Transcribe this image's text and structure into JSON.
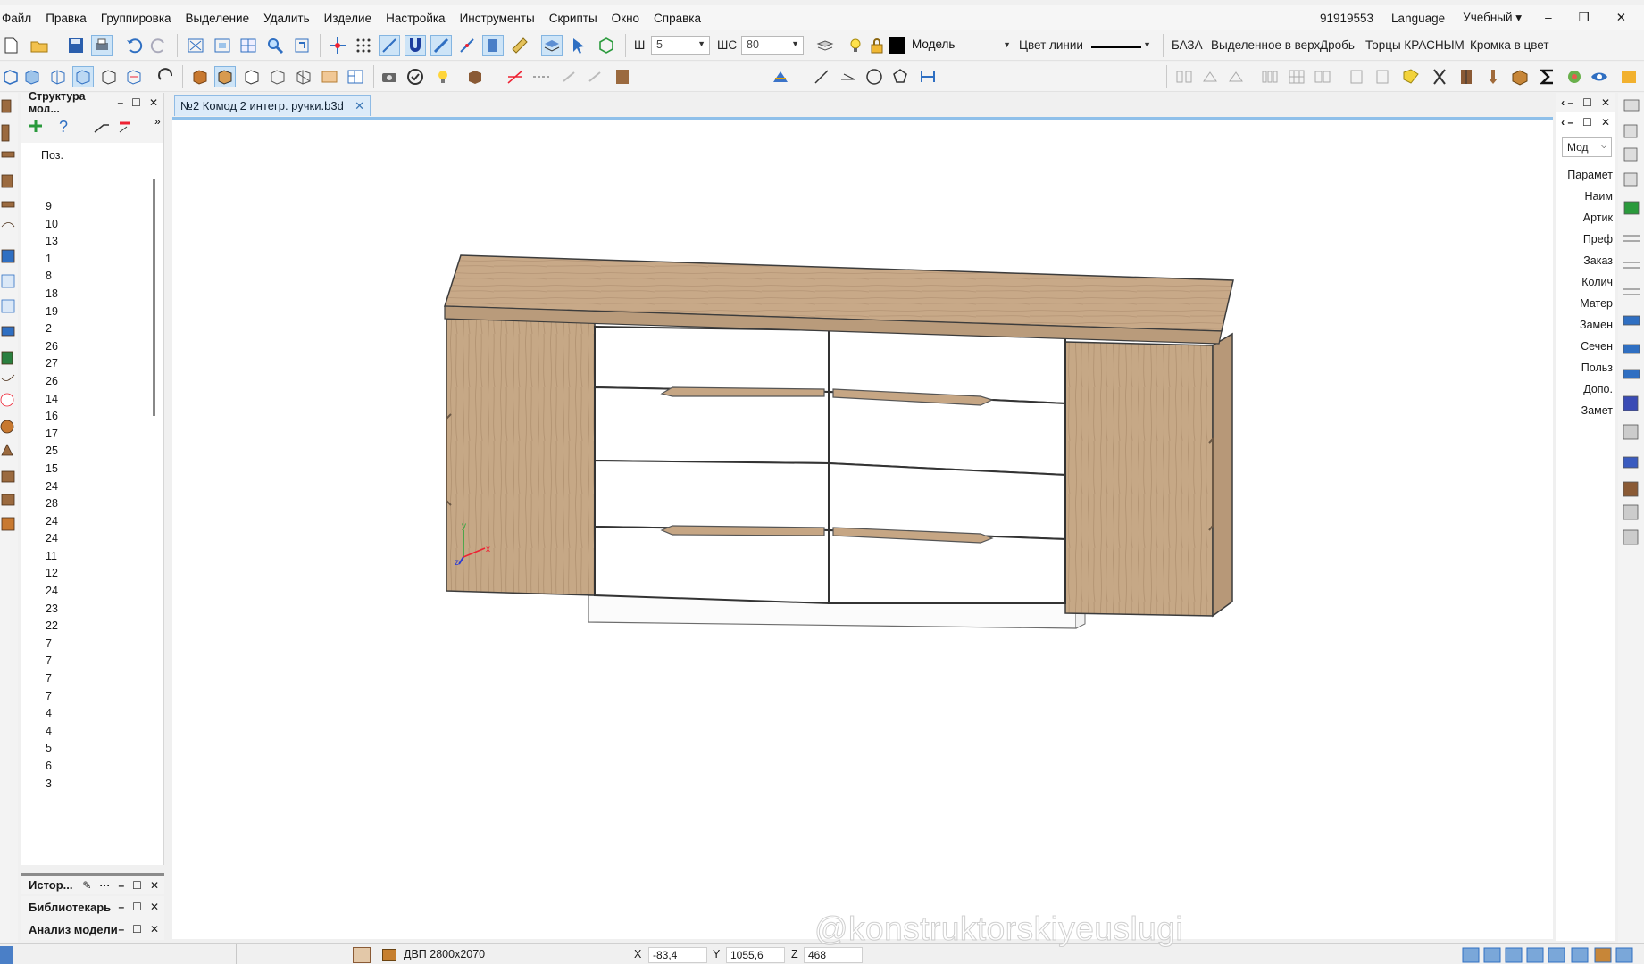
{
  "menu": [
    "Файл",
    "Правка",
    "Группировка",
    "Выделение",
    "Удалить",
    "Изделие",
    "Настройка",
    "Инструменты",
    "Скрипты",
    "Окно",
    "Справка"
  ],
  "menu_right": {
    "code": "91919553",
    "language": "Language",
    "mode": "Учебный ▾"
  },
  "toolbar": {
    "w_label": "Ш",
    "w_value": "5",
    "shc_label": "ШС",
    "shc_value": "80",
    "layer_value": "Модель",
    "line_color_label": "Цвет линии",
    "scripts": [
      "БАЗА",
      "Выделенное в верх",
      "Дробь",
      "Торцы КРАСНЫМ",
      "Кромка в цвет"
    ]
  },
  "structure": {
    "title": "Структура мод...",
    "column": "Поз.",
    "positions": [
      "9",
      "10",
      "13",
      "1",
      "8",
      "18",
      "19",
      "2",
      "26",
      "27",
      "26",
      "14",
      "16",
      "17",
      "25",
      "15",
      "24",
      "28",
      "24",
      "24",
      "11",
      "12",
      "24",
      "23",
      "22",
      "7",
      "7",
      "7",
      "7",
      "4",
      "4",
      "5",
      "6",
      "3"
    ]
  },
  "bottom_panels": [
    "Истор...",
    "Библиотекарь",
    "Анализ модели"
  ],
  "doc_tab": "№2 Комод  2 интегр. ручки.b3d",
  "props": {
    "combo": "Мод",
    "items": [
      "Парамет",
      "Наим",
      "Артик",
      "Преф",
      "Заказ",
      "Колич",
      "Матер",
      "Замен",
      "Сечен",
      "Польз",
      "Допо.",
      "Замет"
    ]
  },
  "status": {
    "material": "ДВП 2800x2070",
    "x_label": "X",
    "x_value": "-83,4",
    "y_label": "Y",
    "y_value": "1055,6",
    "z_label": "Z",
    "z_value": "468"
  },
  "watermark": "@konstruktorskiyeuslugi",
  "colors": {
    "wood": "#c4a584",
    "tab": "#dcebf9",
    "accent": "#2f7fd1"
  }
}
